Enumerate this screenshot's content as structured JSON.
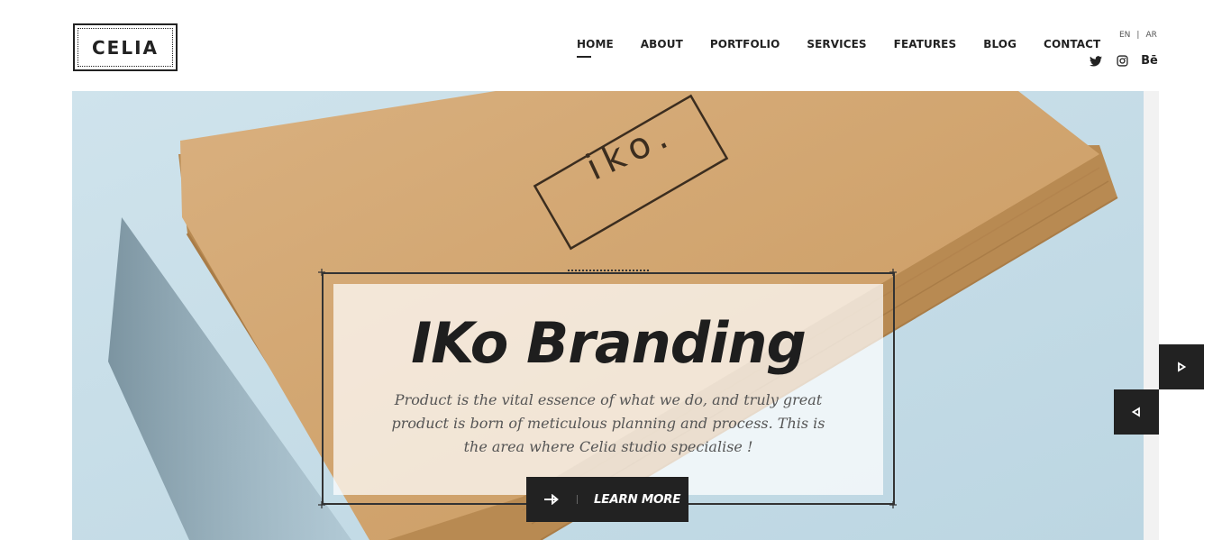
{
  "brand": {
    "logo_text": "CELIA"
  },
  "nav": {
    "items": [
      {
        "label": "HOME",
        "active": true
      },
      {
        "label": "ABOUT"
      },
      {
        "label": "PORTFOLIO"
      },
      {
        "label": "SERVICES"
      },
      {
        "label": "FEATURES"
      },
      {
        "label": "BLOG"
      },
      {
        "label": "CONTACT"
      }
    ]
  },
  "languages": {
    "en": "EN",
    "separator": "|",
    "ar": "AR"
  },
  "social": [
    {
      "icon": "twitter-icon"
    },
    {
      "icon": "instagram-icon"
    },
    {
      "icon": "behance-icon",
      "text": "Bē"
    }
  ],
  "hero": {
    "box_text": "iko.",
    "title": "IKo Branding",
    "description": "Product is the vital essence of what we do, and truly great product is born of meticulous planning and process. This is the area where Celia studio specialise !",
    "cta_label": "LEARN MORE"
  },
  "colors": {
    "dark": "#222222",
    "sky": "#c4dbe6",
    "kraft": "#d1a36e"
  }
}
